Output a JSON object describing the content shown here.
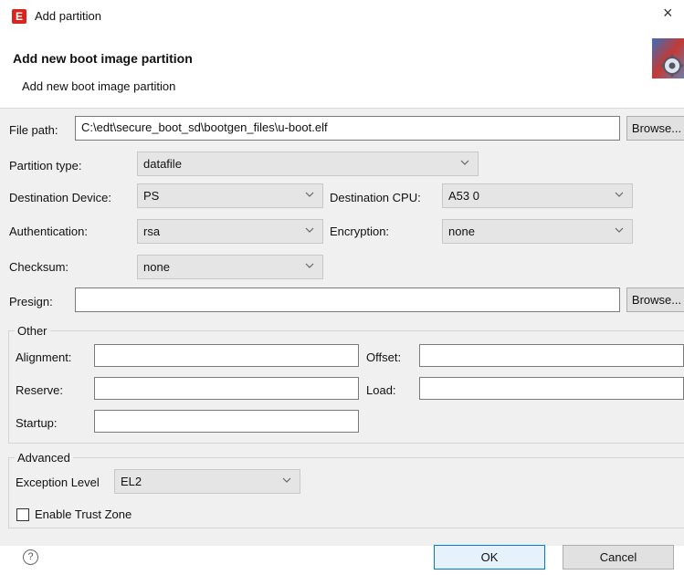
{
  "window": {
    "title": "Add partition",
    "close_glyph": "×",
    "app_icon_glyph": "E"
  },
  "header": {
    "title": "Add new boot image partition",
    "subtitle": "Add new boot image partition"
  },
  "file_path": {
    "label": "File path:",
    "value": "C:\\edt\\secure_boot_sd\\bootgen_files\\u-boot.elf",
    "browse_label": "Browse..."
  },
  "partition_type": {
    "label": "Partition type:",
    "value": "datafile"
  },
  "destination_device": {
    "label": "Destination Device:",
    "value": "PS"
  },
  "destination_cpu": {
    "label": "Destination CPU:",
    "value": "A53 0"
  },
  "authentication": {
    "label": "Authentication:",
    "value": "rsa"
  },
  "encryption": {
    "label": "Encryption:",
    "value": "none"
  },
  "checksum": {
    "label": "Checksum:",
    "value": "none"
  },
  "presign": {
    "label": "Presign:",
    "value": "",
    "browse_label": "Browse..."
  },
  "other": {
    "title": "Other",
    "alignment_label": "Alignment:",
    "alignment_value": "",
    "offset_label": "Offset:",
    "offset_value": "",
    "reserve_label": "Reserve:",
    "reserve_value": "",
    "load_label": "Load:",
    "load_value": "",
    "startup_label": "Startup:",
    "startup_value": ""
  },
  "advanced": {
    "title": "Advanced",
    "exception_level_label": "Exception Level",
    "exception_level_value": "EL2",
    "trust_zone_label": "Enable Trust Zone",
    "trust_zone_checked": false
  },
  "footer": {
    "help_glyph": "?",
    "ok_label": "OK",
    "cancel_label": "Cancel"
  },
  "icons": [
    "app-logo-icon",
    "close-icon",
    "settings-gear-icon",
    "chevron-down-icon",
    "help-icon"
  ],
  "colors": {
    "accent": "#0078d7",
    "app_icon": "#d9261c",
    "panel_bg": "#f0f0f0"
  }
}
